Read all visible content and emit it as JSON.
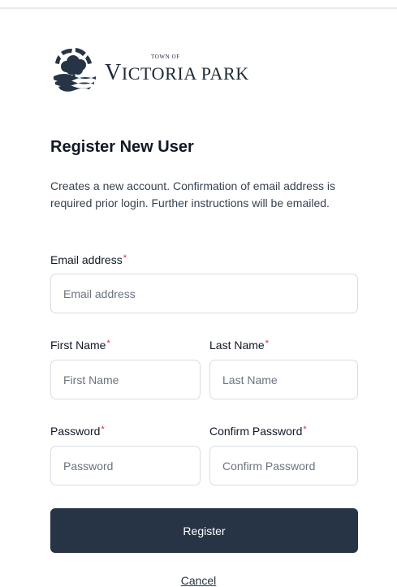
{
  "logo": {
    "town_of": "TOWN OF",
    "name_v": "V",
    "name_rest": "ICTORIA PARK"
  },
  "form": {
    "title": "Register New User",
    "description": "Creates a new account. Confirmation of email address is required prior login. Further instructions will be emailed.",
    "required_mark": "*",
    "email": {
      "label": "Email address",
      "placeholder": "Email address",
      "value": ""
    },
    "first_name": {
      "label": "First Name",
      "placeholder": "First Name",
      "value": ""
    },
    "last_name": {
      "label": "Last Name",
      "placeholder": "Last Name",
      "value": ""
    },
    "password": {
      "label": "Password",
      "placeholder": "Password",
      "value": ""
    },
    "confirm_password": {
      "label": "Confirm Password",
      "placeholder": "Confirm Password",
      "value": ""
    },
    "register_label": "Register",
    "cancel_label": "Cancel"
  },
  "colors": {
    "button_bg": "#263445",
    "required": "#e11d48",
    "input_border": "#d8dce3"
  },
  "icons": {
    "logo": "tree-emblem-icon"
  }
}
